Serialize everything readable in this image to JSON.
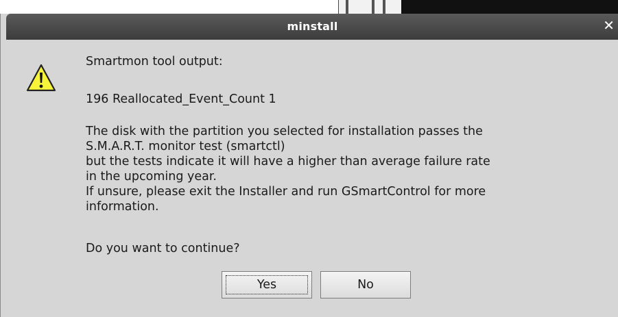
{
  "window": {
    "title": "minstall",
    "close_glyph": "✕"
  },
  "dialog": {
    "icon": "warning-icon",
    "heading": "Smartmon tool output:",
    "detail": "196 Reallocated_Event_Count 1",
    "body_lines": [
      "The disk with the partition you selected for installation passes the",
      "S.M.A.R.T. monitor test (smartctl)",
      "but the tests indicate it will have a higher than average failure rate",
      "in the upcoming year.",
      "If unsure, please exit the Installer and run GSmartControl for more",
      "information."
    ],
    "question": "Do you want to continue?"
  },
  "buttons": {
    "yes_label": "Yes",
    "no_label": "No"
  },
  "colors": {
    "titlebar": "#4a4a4a",
    "dialog_bg": "#d6d6d6",
    "warning_fill": "#f7f23a"
  }
}
